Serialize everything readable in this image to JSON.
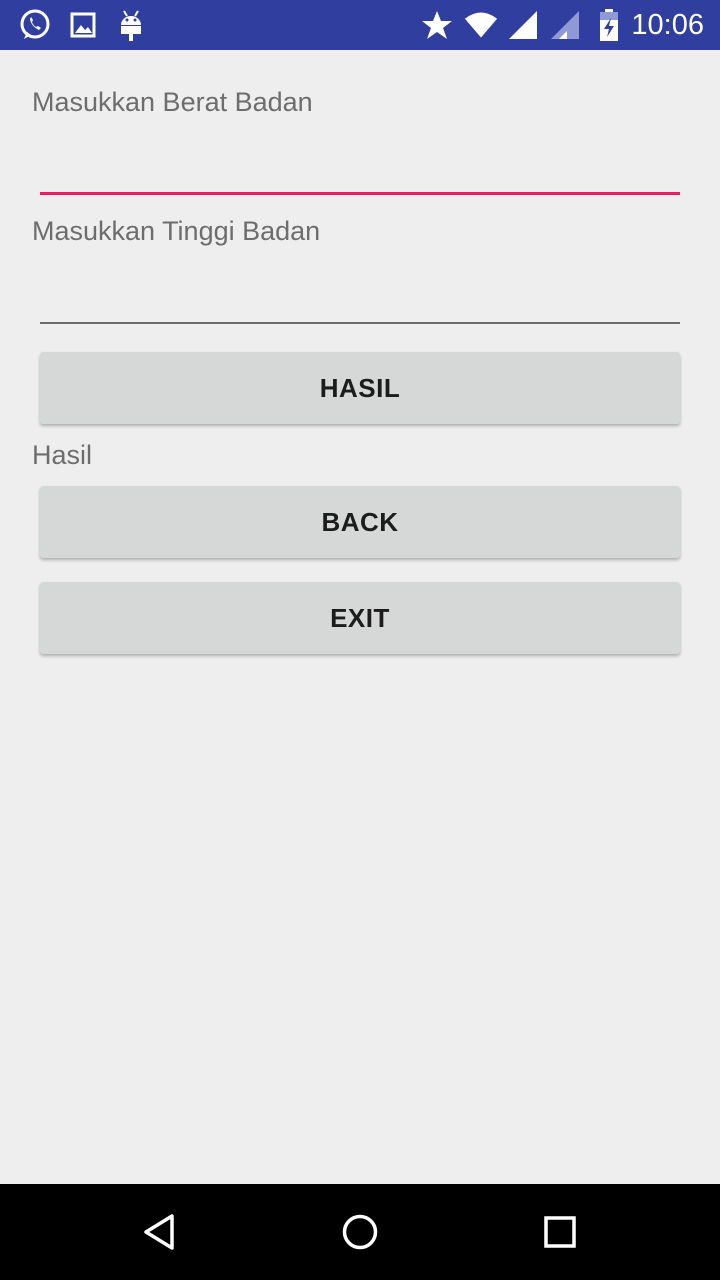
{
  "status_bar": {
    "time": "10:06",
    "background": "#303f9f",
    "left_icons": [
      "whatsapp-icon",
      "image-icon",
      "android-icon"
    ],
    "right_icons": [
      "star-icon",
      "wifi-icon",
      "signal-icon",
      "signal-weak-icon",
      "battery-charging-icon"
    ]
  },
  "form": {
    "weight_label": "Masukkan Berat Badan",
    "weight_value": "",
    "height_label": "Masukkan Tinggi Badan",
    "height_value": "",
    "focused_line_color": "#e91e63",
    "unfocused_line_color": "#6d6d6d"
  },
  "buttons": {
    "hasil": "HASIL",
    "back": "BACK",
    "exit": "EXIT"
  },
  "result": {
    "label": "Hasil"
  },
  "nav_bar": {
    "icons": [
      "back-icon",
      "home-icon",
      "recents-icon"
    ]
  }
}
